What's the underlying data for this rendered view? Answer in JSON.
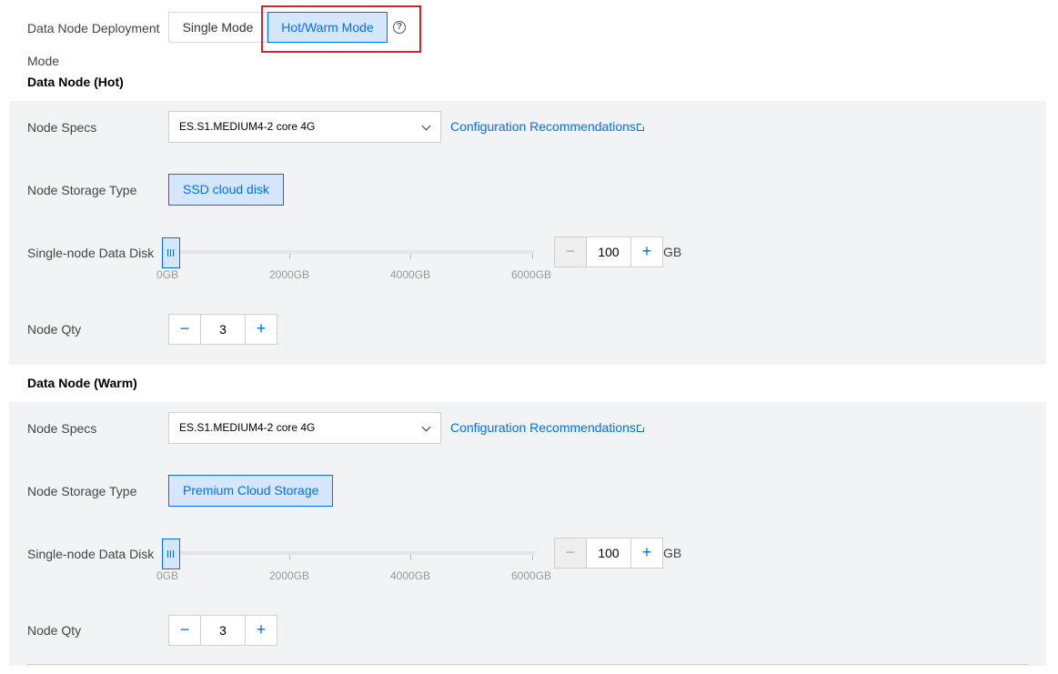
{
  "deployment": {
    "label_line1": "Data Node Deployment",
    "label_line2": "Mode",
    "single_label": "Single Mode",
    "hotwarm_label": "Hot/Warm Mode",
    "help_glyph": "?"
  },
  "hot": {
    "title": "Data Node (Hot)",
    "specs_label": "Node Specs",
    "specs_value": "ES.S1.MEDIUM4-2 core 4G",
    "config_link": "Configuration Recommendations",
    "storage_label": "Node Storage Type",
    "storage_value": "SSD cloud disk",
    "disk_label": "Single-node Data Disk",
    "ticks": [
      "0GB",
      "2000GB",
      "4000GB",
      "6000GB"
    ],
    "disk_value": "100",
    "disk_unit": "GB",
    "qty_label": "Node Qty",
    "qty_value": "3"
  },
  "warm": {
    "title": "Data Node (Warm)",
    "specs_label": "Node Specs",
    "specs_value": "ES.S1.MEDIUM4-2 core 4G",
    "config_link": "Configuration Recommendations",
    "storage_label": "Node Storage Type",
    "storage_value": "Premium Cloud Storage",
    "disk_label": "Single-node Data Disk",
    "ticks": [
      "0GB",
      "2000GB",
      "4000GB",
      "6000GB"
    ],
    "disk_value": "100",
    "disk_unit": "GB",
    "qty_label": "Node Qty",
    "qty_value": "3"
  },
  "glyphs": {
    "minus": "−",
    "plus": "+"
  },
  "colors": {
    "accent": "#006eff",
    "accent_bg": "#d5e7ff",
    "highlight": "#d0262d",
    "panel_bg": "#f2f3f5"
  }
}
